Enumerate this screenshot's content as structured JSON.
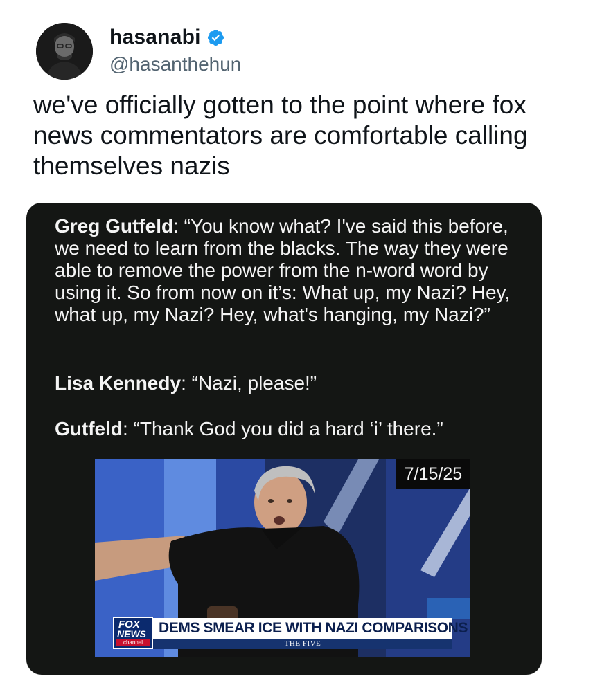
{
  "author": {
    "display_name": "hasanabi",
    "handle": "@hasanthehun",
    "verified": true,
    "avatar_icon": "profile-photo"
  },
  "tweet": {
    "text": "we've officially gotten to the point where fox news commentators are comfortable calling themselves nazis"
  },
  "quote_image": {
    "lines": [
      {
        "speaker": "Greg Gutfeld",
        "text": ": “You know what? I've said this before, we need to learn from the blacks. The way they were able to remove the power from the n-word word by using it. So from now on it’s: What up, my Nazi? Hey, what up, my Nazi? Hey, what's hanging, my Nazi?”"
      },
      {
        "speaker": "Lisa Kennedy",
        "text": ": “Nazi, please!”"
      },
      {
        "speaker": "Gutfeld",
        "text": ": “Thank God you did a hard ‘i’ there.”"
      }
    ],
    "video": {
      "date": "7/15/25",
      "network_logo": {
        "top": "FOX",
        "bottom": "NEWS",
        "sub": "channel"
      },
      "headline": "DEMS SMEAR ICE WITH NAZI COMPARISONS",
      "show_name": "THE FIVE"
    }
  },
  "colors": {
    "verified_blue": "#1d9bf0",
    "card_background": "#141614",
    "handle_gray": "#536471"
  }
}
